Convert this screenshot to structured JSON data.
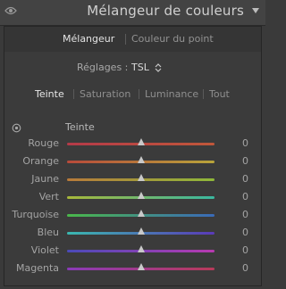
{
  "header": {
    "title": "Mélangeur de couleurs",
    "eye_icon": "eye-icon",
    "collapse_icon": "chevron-down-icon"
  },
  "modes": [
    {
      "label": "Mélangeur",
      "active": true
    },
    {
      "label": "Couleur du point",
      "active": false
    }
  ],
  "settings": {
    "label": "Réglages :",
    "value": "TSL",
    "icon": "up-down-arrows-icon"
  },
  "subtabs": [
    {
      "label": "Teinte",
      "active": true
    },
    {
      "label": "Saturation",
      "active": false
    },
    {
      "label": "Luminance",
      "active": false
    },
    {
      "label": "Tout",
      "active": false
    }
  ],
  "group": {
    "title": "Teinte",
    "target_icon": "target-adjust-icon"
  },
  "sliders": [
    {
      "label": "Rouge",
      "value": "0",
      "position": 0.5,
      "gradient": [
        "#b43a48",
        "#c0573a"
      ]
    },
    {
      "label": "Orange",
      "value": "0",
      "position": 0.5,
      "gradient": [
        "#b84a3a",
        "#b8a43a"
      ]
    },
    {
      "label": "Jaune",
      "value": "0",
      "position": 0.5,
      "gradient": [
        "#b87a3a",
        "#8fb83a"
      ]
    },
    {
      "label": "Vert",
      "value": "0",
      "position": 0.5,
      "gradient": [
        "#a8b83a",
        "#3ab8a0"
      ]
    },
    {
      "label": "Turquoise",
      "value": "0",
      "position": 0.5,
      "gradient": [
        "#4ab84a",
        "#3a6ab8"
      ]
    },
    {
      "label": "Bleu",
      "value": "0",
      "position": 0.5,
      "gradient": [
        "#3ab8b0",
        "#5a3ab8"
      ]
    },
    {
      "label": "Violet",
      "value": "0",
      "position": 0.5,
      "gradient": [
        "#4a4ab8",
        "#b83ab0"
      ]
    },
    {
      "label": "Magenta",
      "value": "0",
      "position": 0.5,
      "gradient": [
        "#8a3ab8",
        "#b83a5a"
      ]
    }
  ]
}
